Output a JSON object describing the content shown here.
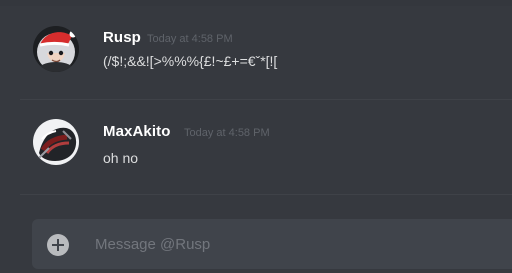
{
  "messages": [
    {
      "author": "Rusp",
      "timestamp": "Today at 4:58 PM",
      "text": "(/$!;&&![>%%%{£!~£+=€ˇ*[![",
      "avatar_icon": "user-avatar-icon"
    },
    {
      "author": "MaxAkito",
      "timestamp": "Today at 4:58 PM",
      "text": "oh no",
      "avatar_icon": "user-avatar-icon"
    }
  ],
  "composer": {
    "placeholder": "Message @Rusp",
    "attach_icon": "plus-circle-icon"
  },
  "colors": {
    "background": "#36393f",
    "composer": "#40444b",
    "username": "#ffffff",
    "timestamp": "#5f636a",
    "message_text": "#dcddde",
    "placeholder": "#72767d"
  }
}
